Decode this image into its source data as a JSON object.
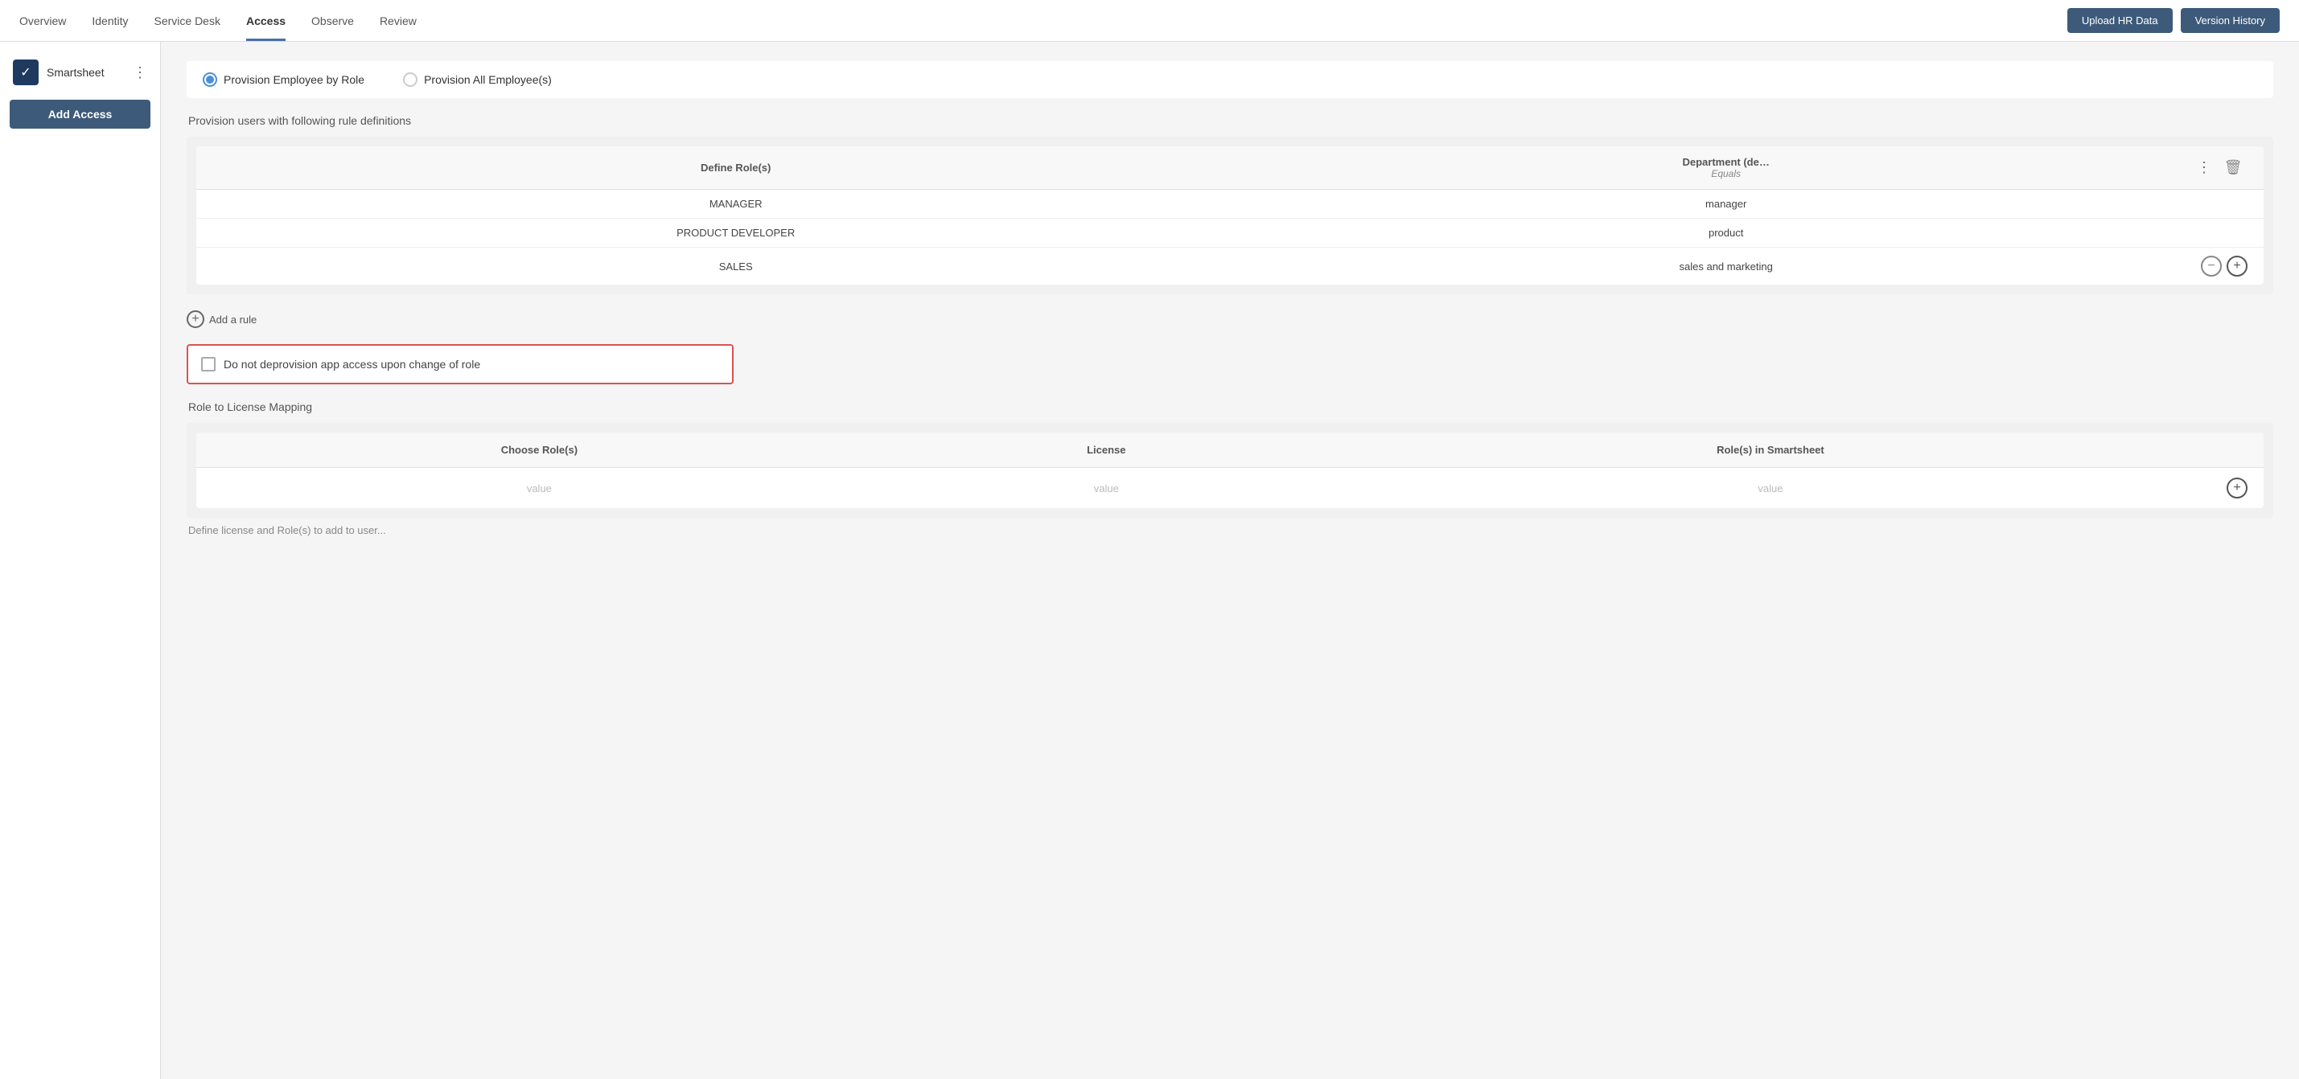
{
  "nav": {
    "tabs": [
      {
        "id": "overview",
        "label": "Overview",
        "active": false
      },
      {
        "id": "identity",
        "label": "Identity",
        "active": false
      },
      {
        "id": "service-desk",
        "label": "Service Desk",
        "active": false
      },
      {
        "id": "access",
        "label": "Access",
        "active": true
      },
      {
        "id": "observe",
        "label": "Observe",
        "active": false
      },
      {
        "id": "review",
        "label": "Review",
        "active": false
      }
    ],
    "upload_btn": "Upload HR Data",
    "version_btn": "Version History"
  },
  "sidebar": {
    "app_name": "Smartsheet",
    "app_icon": "✓",
    "add_access_label": "Add Access"
  },
  "provision": {
    "title": "Provision users with following rule definitions",
    "option1": "Provision Employee by Role",
    "option2": "Provision All Employee(s)",
    "selected": "option1"
  },
  "rule_table": {
    "col1_header": "Define Role(s)",
    "col2_header": "Department (de…",
    "col2_sub": "Equals",
    "rows": [
      {
        "role": "MANAGER",
        "dept": "manager"
      },
      {
        "role": "PRODUCT DEVELOPER",
        "dept": "product"
      },
      {
        "role": "SALES",
        "dept": "sales and marketing"
      }
    ]
  },
  "add_rule": {
    "label": "Add a rule"
  },
  "checkbox": {
    "label": "Do not deprovision app access upon change of role",
    "checked": false
  },
  "license_mapping": {
    "title": "Role to License Mapping",
    "col1": "Choose Role(s)",
    "col2": "License",
    "col3": "Role(s) in Smartsheet",
    "row_value": "value"
  },
  "bottom_hint": "Define license and Role(s) to add to user..."
}
